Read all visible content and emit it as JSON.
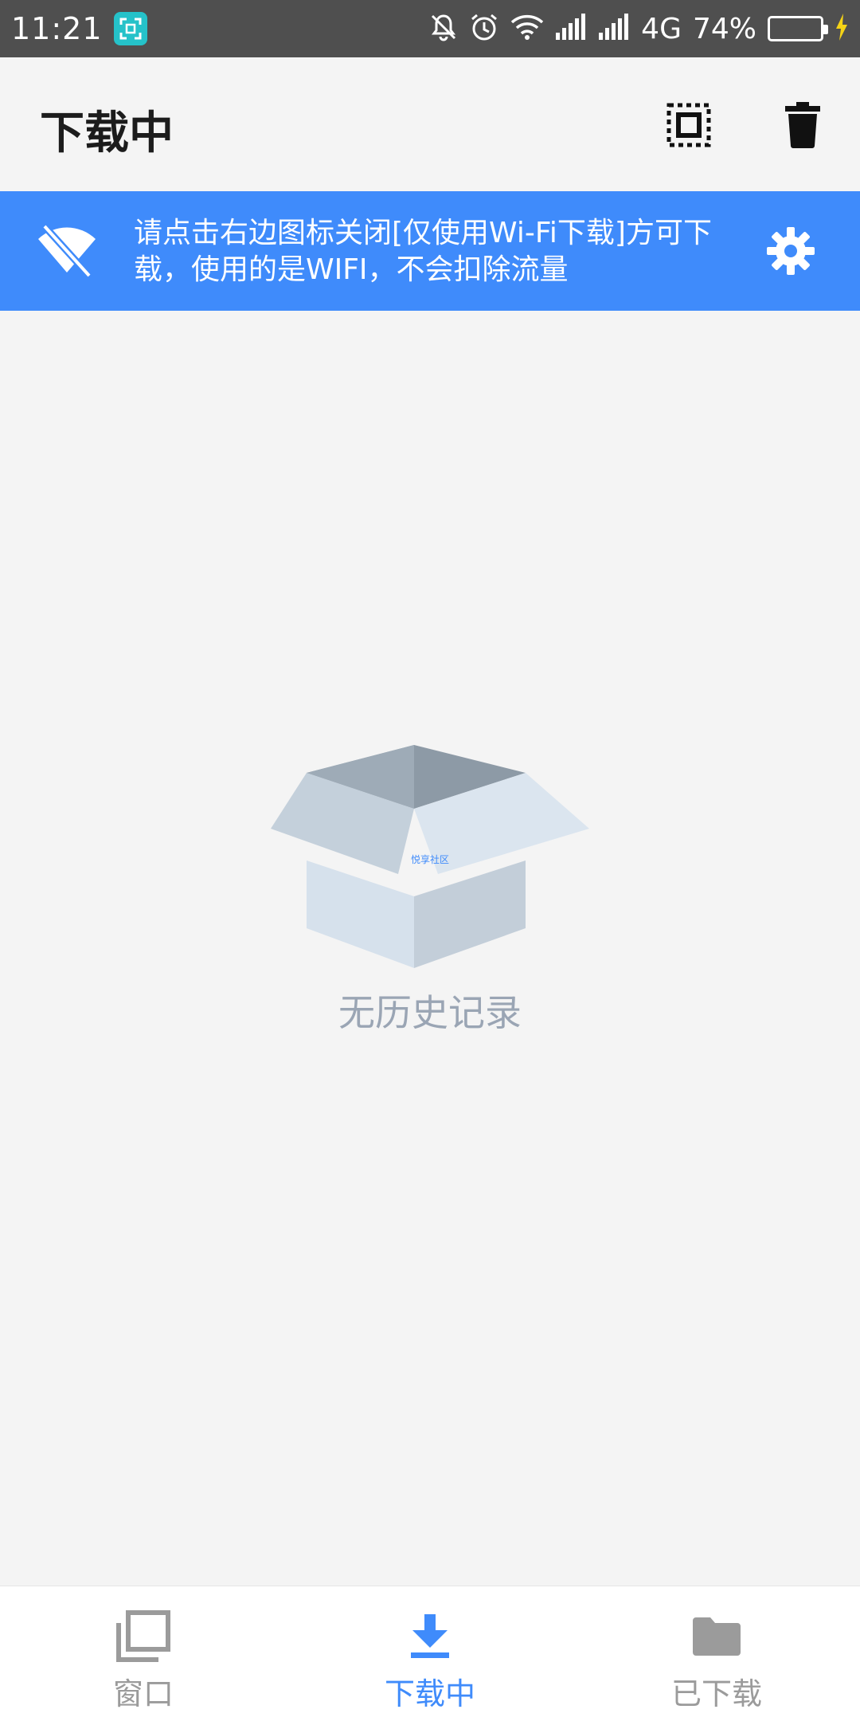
{
  "status_bar": {
    "time": "11:21",
    "network": "4G",
    "battery": "74%",
    "battery_level": 0.74,
    "icons": [
      "screenshot-app-icon",
      "mute-icon",
      "alarm-icon",
      "wifi-icon",
      "signal-icon",
      "signal-icon-2",
      "charging-icon"
    ]
  },
  "header": {
    "title": "下载中",
    "icons": [
      "select-all-icon",
      "trash-icon"
    ]
  },
  "banner": {
    "text": "请点击右边图标关闭[仅使用Wi-Fi下载]方可下载，使用的是WIFI，不会扣除流量",
    "icons": [
      "wifi-off-icon",
      "gear-icon"
    ],
    "color": "#3f8bfb"
  },
  "empty_state": {
    "watermark": "悦享社区",
    "message": "无历史记录"
  },
  "bottom_nav": {
    "items": [
      {
        "label": "窗口",
        "icon": "windows-icon",
        "active": false
      },
      {
        "label": "下载中",
        "icon": "download-icon",
        "active": true
      },
      {
        "label": "已下载",
        "icon": "folder-icon",
        "active": false
      }
    ],
    "active_color": "#3f8bfb",
    "inactive_color": "#9b9b9b"
  }
}
